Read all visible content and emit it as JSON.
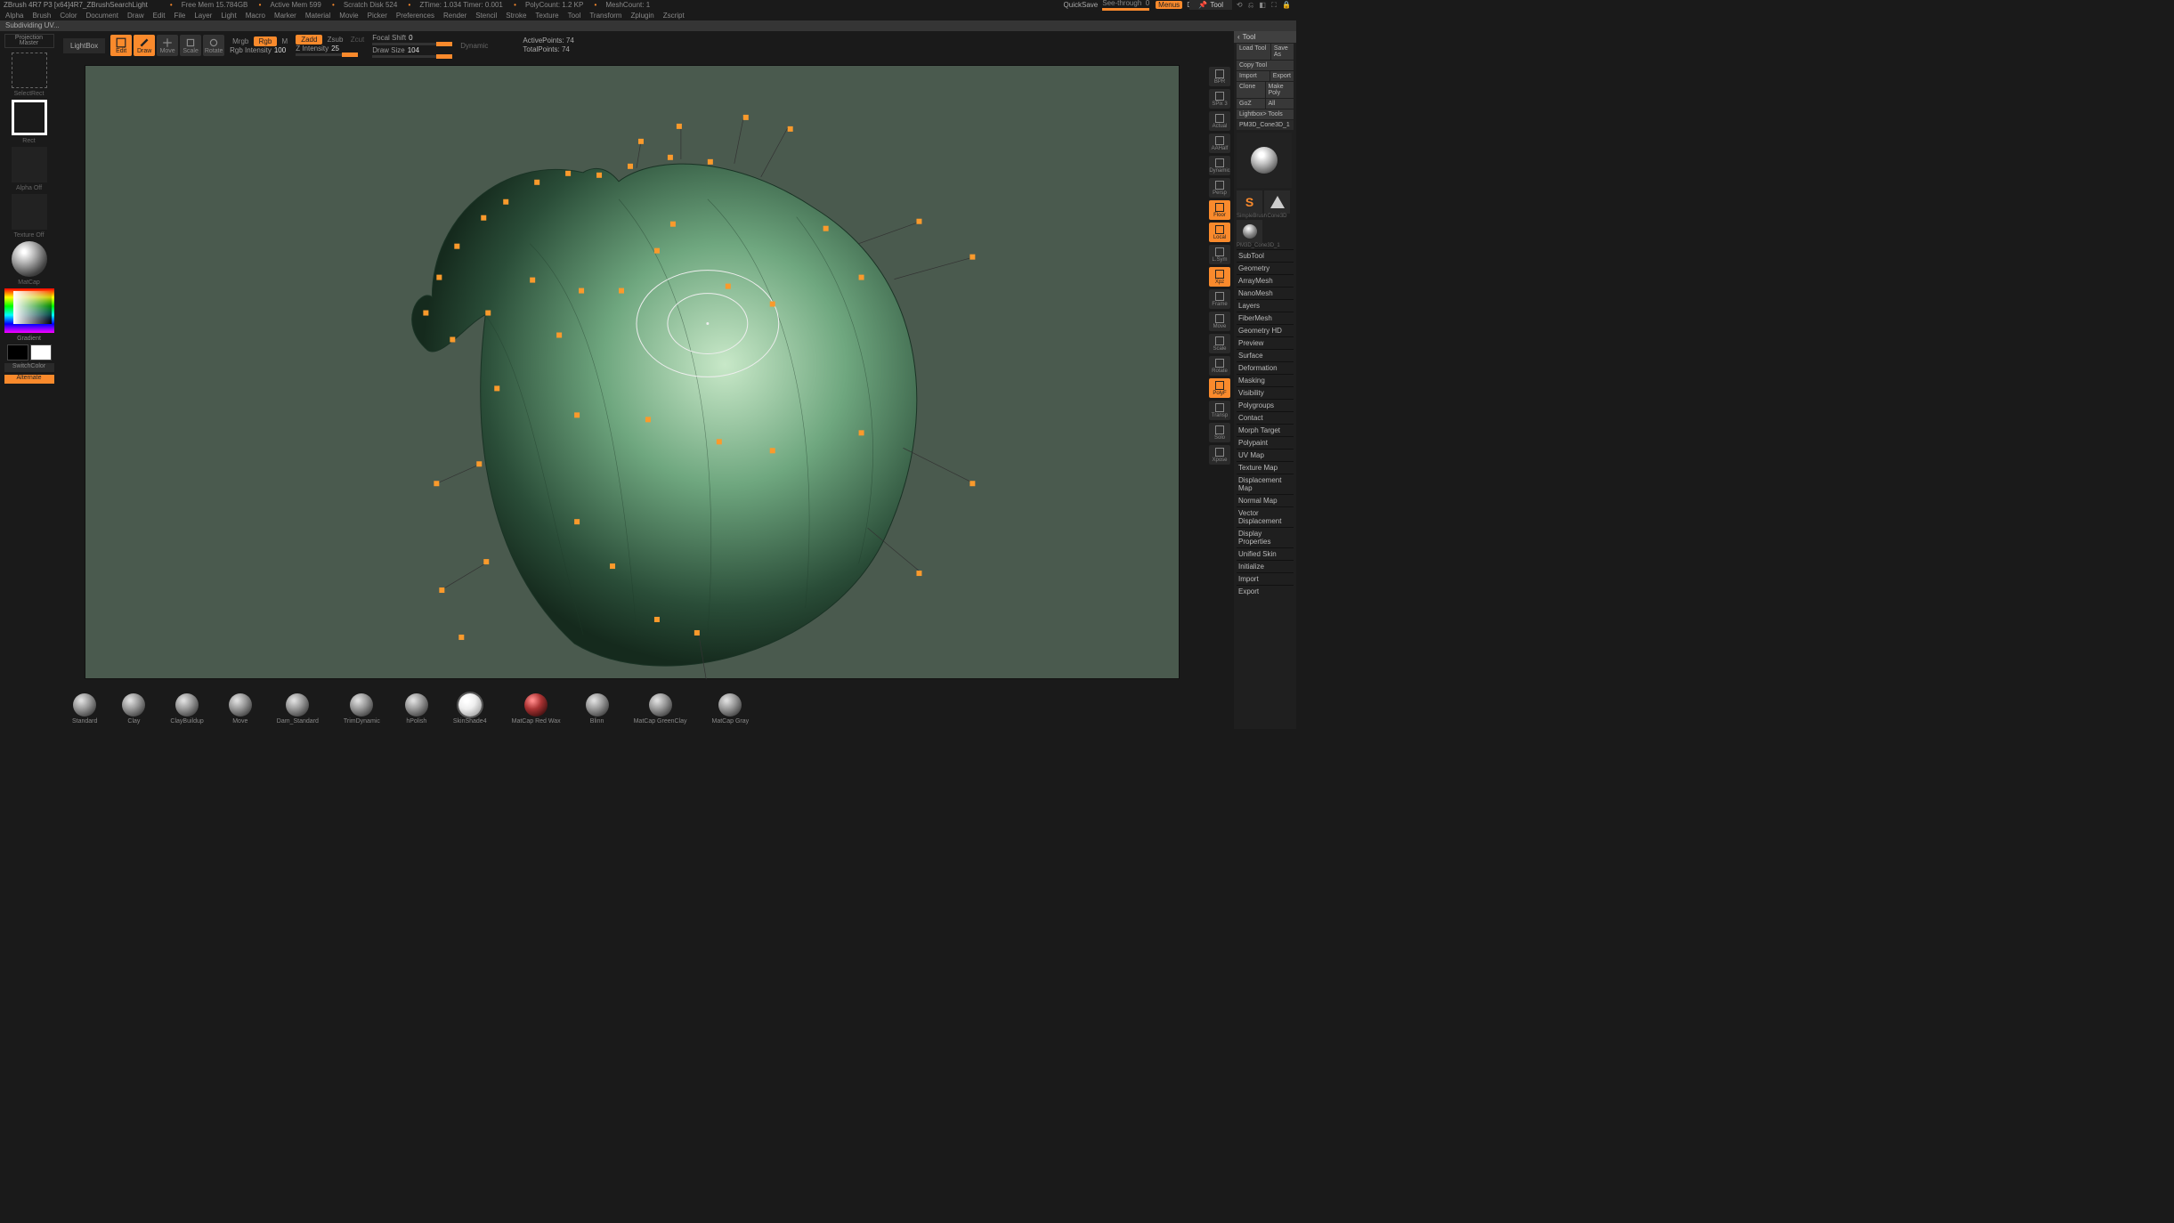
{
  "titlebar": {
    "app": "ZBrush 4R7 P3 [x64]4R7_ZBrushSearchLight",
    "stats": [
      "Free Mem 15.784GB",
      "Active Mem 599",
      "Scratch Disk 524",
      "ZTime: 1.034 Timer: 0.001",
      "PolyCount: 1.2 KP",
      "MeshCount: 1"
    ],
    "quicksave": "QuickSave",
    "seethrough": "See-through",
    "seethrough_val": "0",
    "menus": "Menus",
    "script": "DefaultZScript",
    "tool_tab": "Tool"
  },
  "menubar": [
    "Alpha",
    "Brush",
    "Color",
    "Document",
    "Draw",
    "Edit",
    "File",
    "Layer",
    "Light",
    "Macro",
    "Marker",
    "Material",
    "Movie",
    "Picker",
    "Preferences",
    "Render",
    "Stencil",
    "Stroke",
    "Texture",
    "Tool",
    "Transform",
    "Zplugin",
    "Zscript"
  ],
  "msgbar": "Subdividing UV...",
  "left": {
    "proj_master": "Projection Master",
    "select_lasso": "SelectRect",
    "rect": "Rect",
    "alpha_off": "Alpha Off",
    "texture_off": "Texture Off",
    "material": "MatCap",
    "gradient": "Gradient",
    "switchcolor": "SwitchColor",
    "alternate": "Alternate"
  },
  "toolbar": {
    "lightbox": "LightBox",
    "edit": "Edit",
    "draw": "Draw",
    "move": "Move",
    "scale": "Scale",
    "rotate": "Rotate",
    "mrgb": "Mrgb",
    "rgb": "Rgb",
    "m": "M",
    "rgb_intensity": "Rgb Intensity",
    "rgb_intensity_val": "100",
    "zadd": "Zadd",
    "zsub": "Zsub",
    "zcut": "Zcut",
    "z_intensity": "Z Intensity",
    "z_intensity_val": "25",
    "focal": "Focal Shift",
    "focal_val": "0",
    "draw_size": "Draw Size",
    "draw_size_val": "104",
    "dynamic": "Dynamic",
    "activepts": "ActivePoints:",
    "activepts_v": "74",
    "totalpts": "TotalPoints:",
    "totalpts_v": "74"
  },
  "brushbar": [
    {
      "name": "Standard"
    },
    {
      "name": "Clay"
    },
    {
      "name": "ClayBuildup"
    },
    {
      "name": "Move"
    },
    {
      "name": "Dam_Standard"
    },
    {
      "name": "TrimDynamic"
    },
    {
      "name": "hPolish"
    },
    {
      "name": "SkinShade4",
      "sel": true
    },
    {
      "name": "MatCap Red Wax",
      "red": true
    },
    {
      "name": "Blinn"
    },
    {
      "name": "MatCap GreenClay"
    },
    {
      "name": "MatCap Gray"
    }
  ],
  "quick": [
    "BPR",
    "SPix 3",
    "Actual",
    "AAHalf",
    "Dynamic",
    "Persp",
    "Floor",
    "Local",
    "L.Sym",
    "Xpz",
    "Frame",
    "Move",
    "Scale",
    "Rotate",
    "PolyF",
    "Transp",
    "Solo",
    "Xpose"
  ],
  "quick_orange": [
    "Floor",
    "Local",
    "Xpz",
    "PolyF"
  ],
  "tool": {
    "header": "Tool",
    "buttons_top": [
      "Load Tool",
      "Save As"
    ],
    "copy": "Copy Tool",
    "import": "Import",
    "export": "Export",
    "clone": "Clone",
    "make_poly": "Make Poly",
    "goz": "GoZ",
    "all": "All",
    "lightbox_tools": "Lightbox> Tools",
    "active_name": "PM3D_Cone3D_1",
    "mini_labels": [
      "SimpleBrush",
      "Cone3D",
      "PM3D_Cone3D_1"
    ],
    "sections": [
      "SubTool",
      "Geometry",
      "ArrayMesh",
      "NanoMesh",
      "Layers",
      "FiberMesh",
      "Geometry HD",
      "Preview",
      "Surface",
      "Deformation",
      "Masking",
      "Visibility",
      "Polygroups",
      "Contact",
      "Morph Target",
      "Polypaint",
      "UV Map",
      "Texture Map",
      "Displacement Map",
      "Normal Map",
      "Vector Displacement",
      "Display Properties",
      "Unified Skin",
      "Initialize",
      "Import",
      "Export"
    ]
  }
}
